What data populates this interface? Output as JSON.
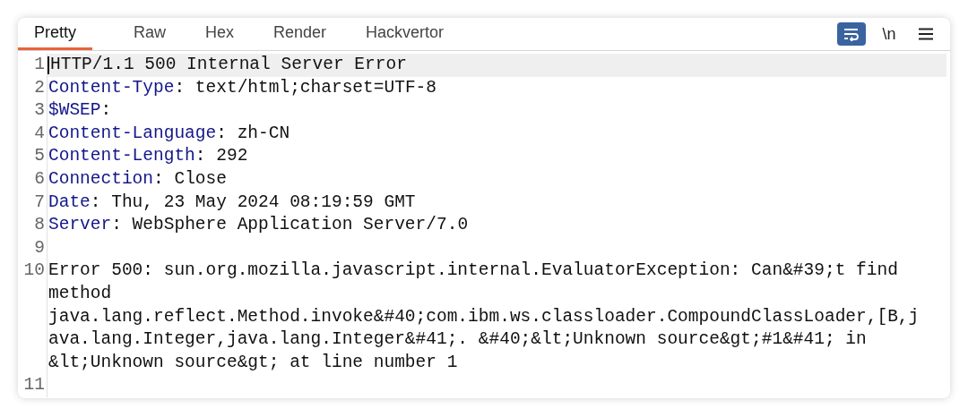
{
  "tabs": [
    {
      "label": "Pretty",
      "selected": true
    },
    {
      "label": "Raw",
      "selected": false
    },
    {
      "label": "Hex",
      "selected": false
    },
    {
      "label": "Render",
      "selected": false
    },
    {
      "label": "Hackvertor",
      "selected": false
    }
  ],
  "toolbar": {
    "wrap_toggle": {
      "on": true
    },
    "newline_toggle": {
      "label": "\\n",
      "on": false
    }
  },
  "lines": [
    {
      "number": "1",
      "kind": "status",
      "text": "HTTP/1.1 500 Internal Server Error",
      "current": true
    },
    {
      "number": "2",
      "kind": "header",
      "name": "Content-Type",
      "sep": ":",
      "value": "text/html;charset=UTF-8",
      "current": false
    },
    {
      "number": "3",
      "kind": "header",
      "name": "$WSEP",
      "sep": ":",
      "current": false
    },
    {
      "number": "4",
      "kind": "header",
      "name": "Content-Language",
      "sep": ":",
      "value": "zh-CN",
      "current": false
    },
    {
      "number": "5",
      "kind": "header",
      "name": "Content-Length",
      "sep": ":",
      "value": "292",
      "current": false
    },
    {
      "number": "6",
      "kind": "header",
      "name": "Connection",
      "sep": ":",
      "value": "Close",
      "current": false
    },
    {
      "number": "7",
      "kind": "header",
      "name": "Date",
      "sep": ":",
      "value": "Thu, 23 May 2024 08:19:59 GMT",
      "current": false
    },
    {
      "number": "8",
      "kind": "header",
      "name": "Server",
      "sep": ":",
      "value": "WebSphere Application Server/7.0",
      "current": false
    },
    {
      "number": "9",
      "kind": "blank",
      "current": false
    },
    {
      "number": "10",
      "kind": "body",
      "wrapped": [
        "Error 500: sun.org.mozilla.javascript.internal.EvaluatorException: Can&#39;t find",
        "method",
        "java.lang.reflect.Method.invoke&#40;com.ibm.ws.classloader.CompoundClassLoader,[B,j",
        "ava.lang.Integer,java.lang.Integer&#41;. &#40;&lt;Unknown source&gt;#1&#41; in",
        "&lt;Unknown source&gt; at line number 1"
      ],
      "current": false
    },
    {
      "number": "11",
      "kind": "blank",
      "current": false
    }
  ]
}
